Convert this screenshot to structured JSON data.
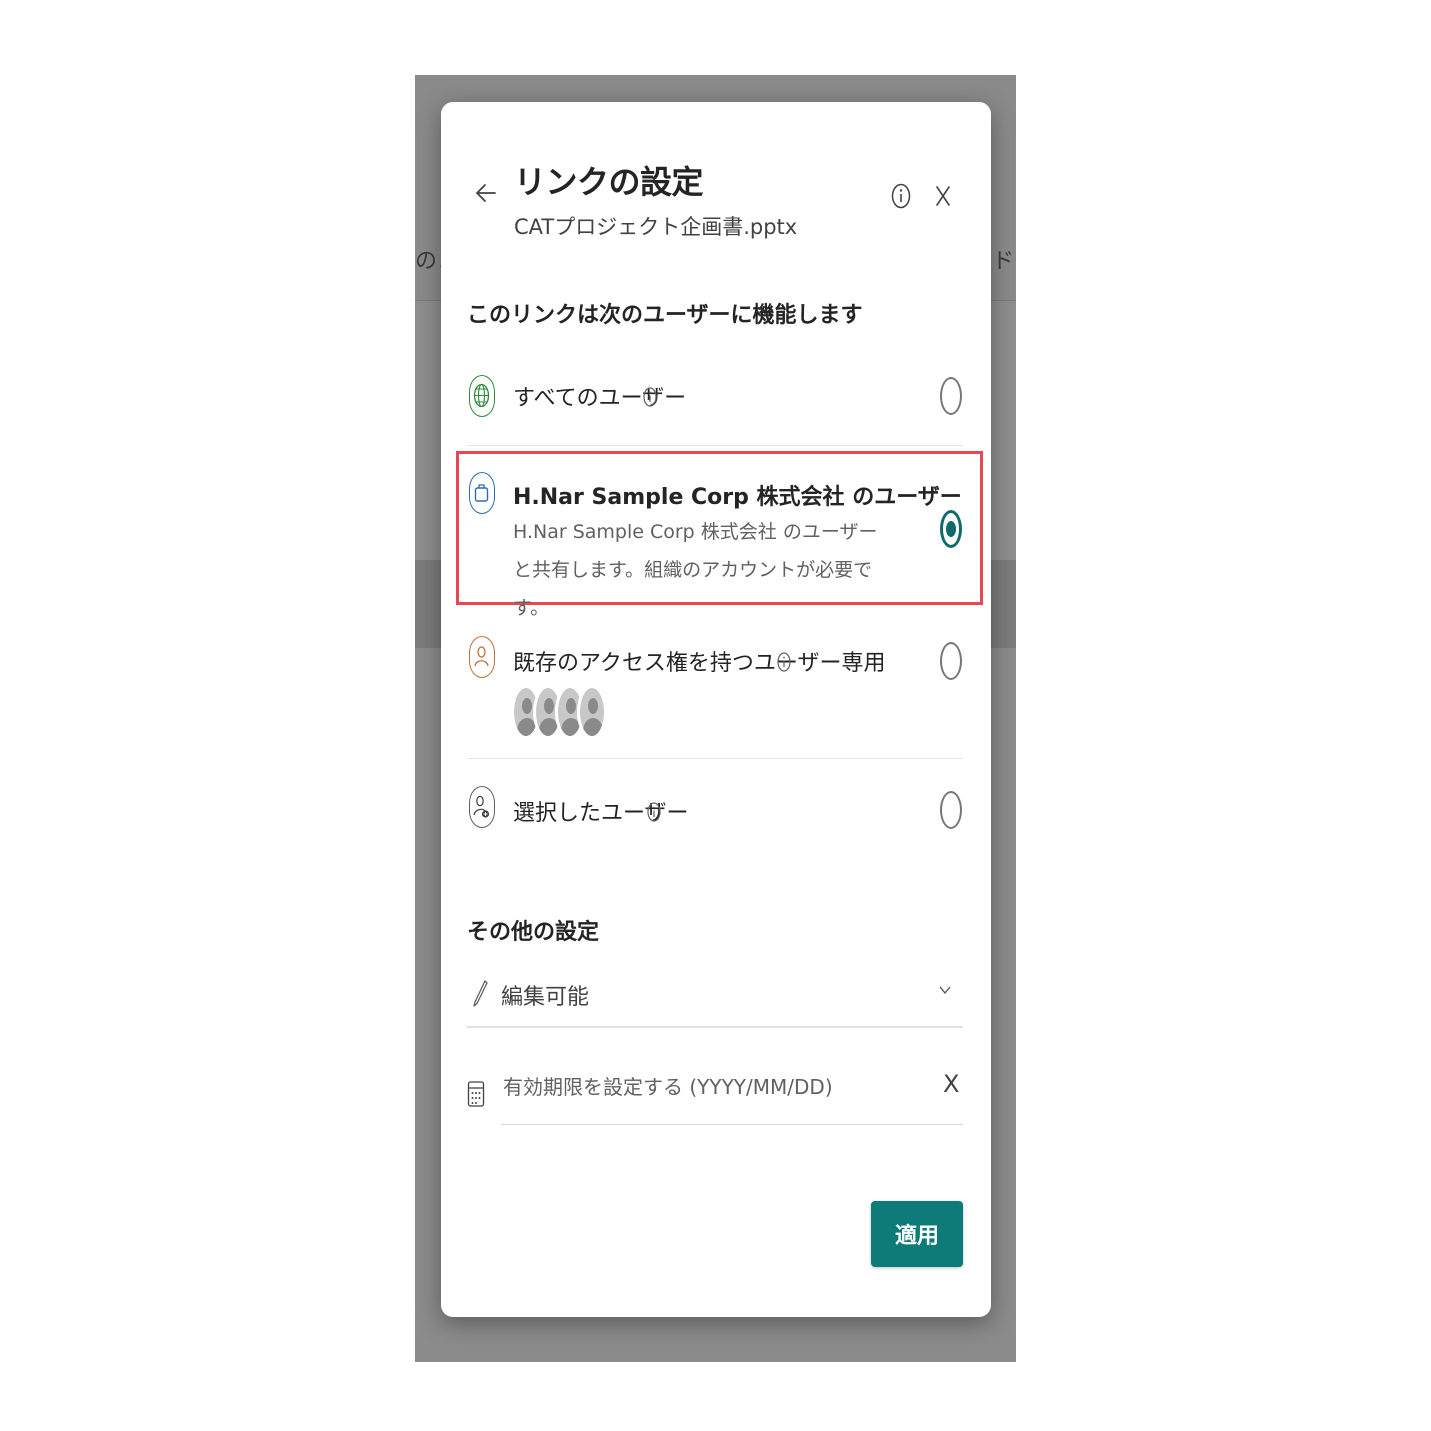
{
  "background": {
    "left_text": "のコピ",
    "right_text": "ド"
  },
  "dialog": {
    "title": "リンクの設定",
    "file_name": "CATプロジェクト企画書.pptx",
    "audience_heading": "このリンクは次のユーザーに機能します",
    "options": [
      {
        "label": "すべてのユーザー",
        "icon": "globe-icon",
        "selected": false
      },
      {
        "label": "H.Nar Sample Corp 株式会社 のユーザー",
        "description": "H.Nar Sample Corp 株式会社 のユーザーと共有します。組織のアカウントが必要です。",
        "icon": "briefcase-icon",
        "selected": true
      },
      {
        "label": "既存のアクセス権を持つユーザー専用",
        "icon": "person-icon",
        "selected": false
      },
      {
        "label": "選択したユーザー",
        "icon": "person-add-icon",
        "selected": false
      }
    ],
    "other_heading": "その他の設定",
    "permission": {
      "value": "編集可能"
    },
    "expiration": {
      "placeholder": "有効期限を設定する (YYYY/MM/DD)",
      "clear_label": "X"
    },
    "apply_label": "適用"
  },
  "colors": {
    "accent": "#0f7b78",
    "highlight_border": "#e8484f",
    "globe": "#2e8b3e",
    "briefcase": "#2b6cb0",
    "person": "#c0703a"
  }
}
